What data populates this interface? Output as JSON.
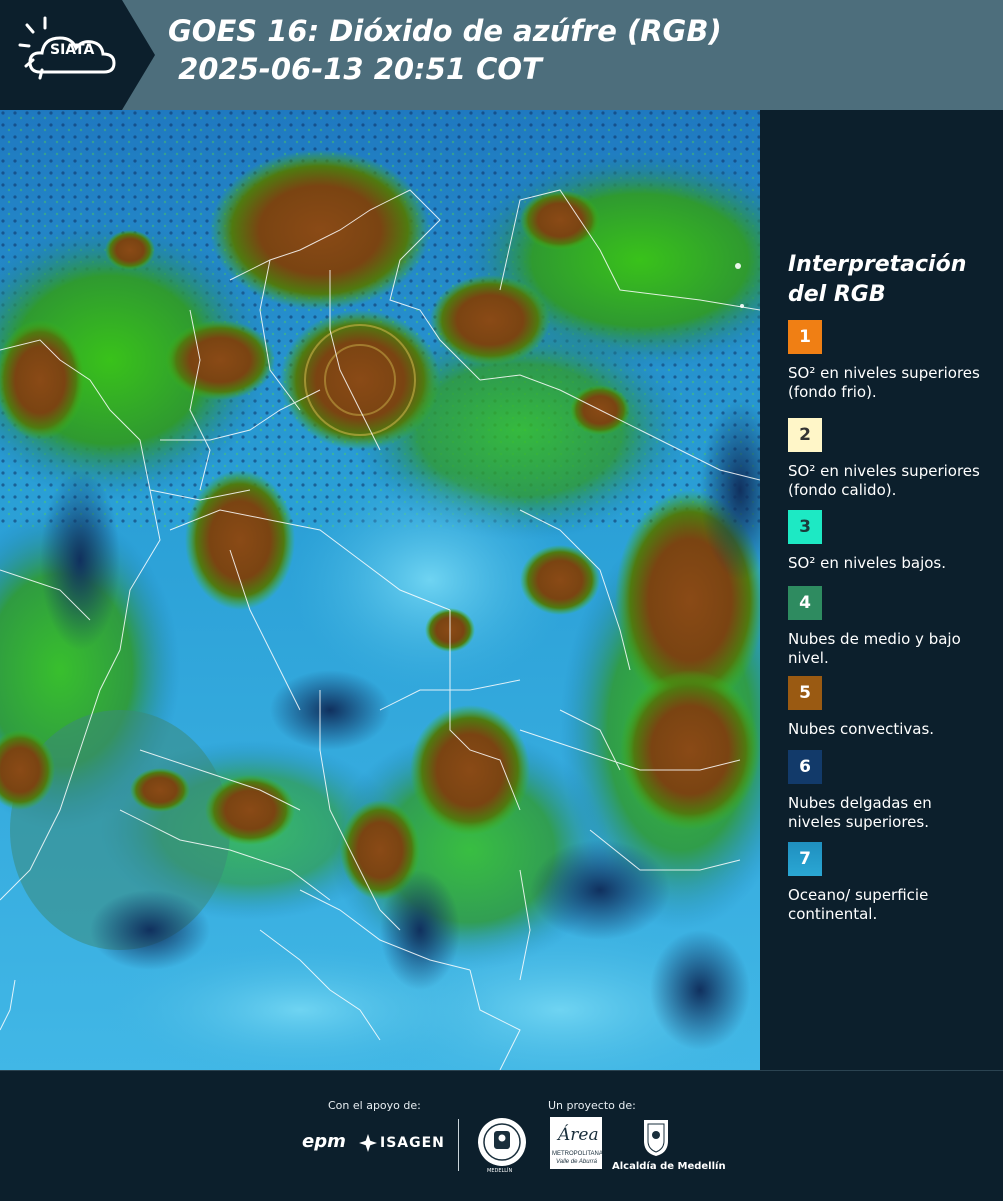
{
  "header": {
    "logo_text": "SIATA",
    "title_line1": "GOES 16: Dióxido de azúfre (RGB)",
    "title_line2": " 2025-06-13 20:51 COT"
  },
  "legend": {
    "title": "Interpretación del RGB",
    "items": [
      {
        "number": "1",
        "color": "#f07f14",
        "text_color": "#ffffff",
        "label": "SO² en niveles superiores (fondo frio)."
      },
      {
        "number": "2",
        "color": "#fff6c8",
        "text_color": "#333333",
        "label": "SO² en niveles superiores (fondo calido)."
      },
      {
        "number": "3",
        "color": "#1de9c4",
        "text_color": "#1a3a3a",
        "label": "SO² en niveles bajos."
      },
      {
        "number": "4",
        "color": "#2e8b60",
        "text_color": "#ffffff",
        "label": "Nubes de medio y bajo nivel."
      },
      {
        "number": "5",
        "color": "#9a5a12",
        "text_color": "#ffffff",
        "label": "Nubes convectivas."
      },
      {
        "number": "6",
        "color": "#123a6a",
        "text_color": "#ffffff",
        "label": "Nubes delgadas en niveles superiores."
      },
      {
        "number": "7",
        "color": "#1f8fbf",
        "text_color": "#ffffff",
        "label": "Oceano/ superficie continental."
      }
    ]
  },
  "footer": {
    "support_label": "Con el apoyo de:",
    "project_label": "Un proyecto de:",
    "epm_text": "epm",
    "isagen_text": "ISAGEN",
    "seal_text": "MEDELLÍN",
    "area_text": "Área",
    "area_subtext": "METROPOLITANA",
    "area_subtext2": "Valle de Aburrá",
    "alcaldia_text": "Alcaldía de Medellín"
  },
  "colors": {
    "header_bg": "#4d6e7c",
    "page_bg": "#0c1f2c"
  }
}
